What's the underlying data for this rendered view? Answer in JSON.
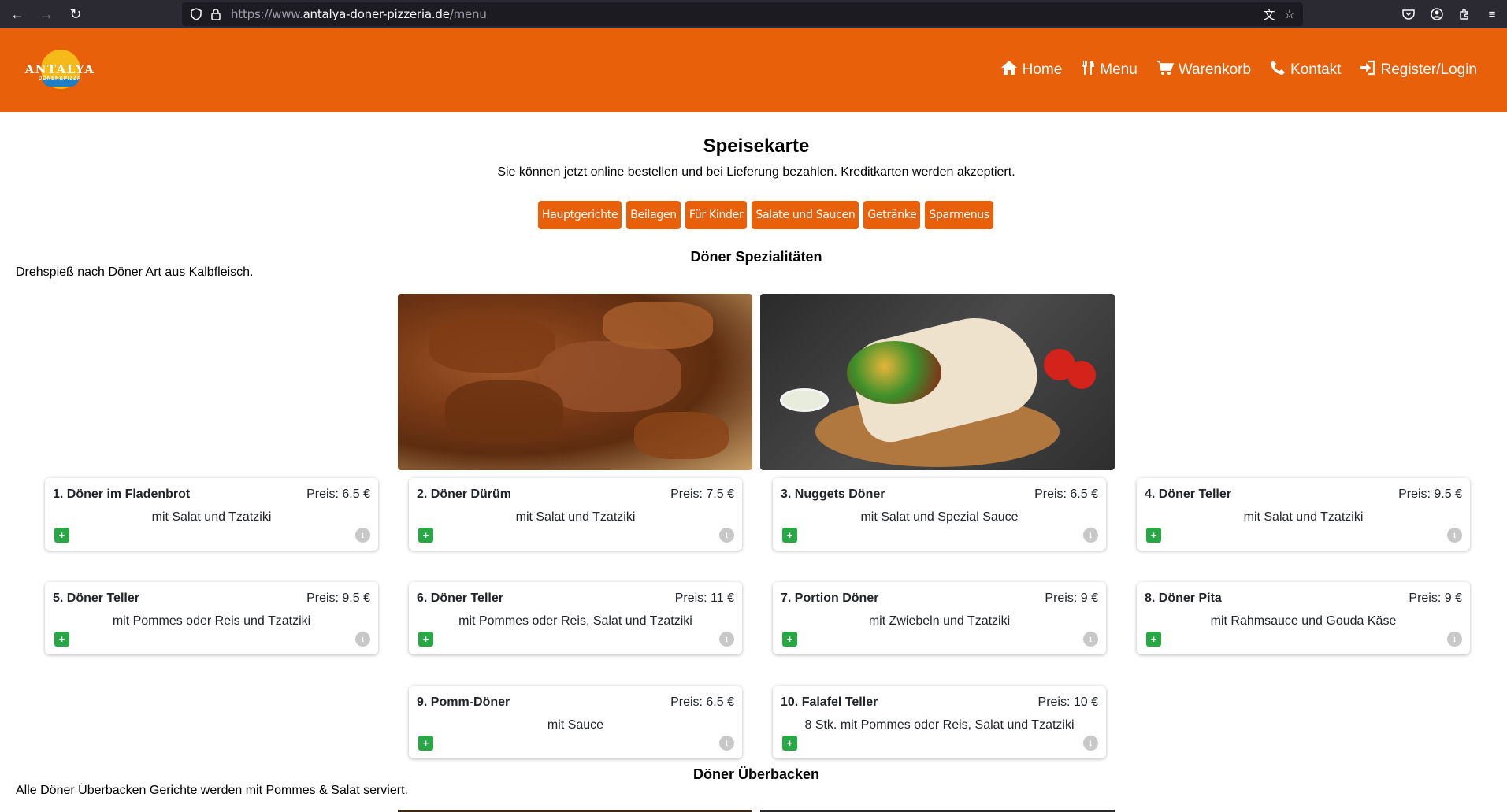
{
  "browser": {
    "url_prefix": "https://www.",
    "url_host": "antalya-doner-pizzeria.de",
    "url_path": "/menu"
  },
  "header": {
    "logo_text": "ANTALYA",
    "logo_sub": "DÖNER&PIZZA",
    "nav": [
      {
        "label": "Home",
        "icon": "home-icon"
      },
      {
        "label": "Menu",
        "icon": "utensils-icon"
      },
      {
        "label": "Warenkorb",
        "icon": "cart-icon"
      },
      {
        "label": "Kontakt",
        "icon": "phone-icon"
      },
      {
        "label": "Register/Login",
        "icon": "login-icon"
      }
    ]
  },
  "page": {
    "title": "Speisekarte",
    "subtitle": "Sie können jetzt online bestellen und bei Lieferung bezahlen. Kreditkarten werden akzeptiert."
  },
  "categories": [
    "Hauptgerichte",
    "Beilagen",
    "Für Kinder",
    "Salate und Saucen",
    "Getränke",
    "Sparmenus"
  ],
  "sections": [
    {
      "title": "Döner Spezialitäten",
      "description": "Drehspieß nach Döner Art aus Kalbfleisch.",
      "items": [
        {
          "name": "1. Döner im Fladenbrot",
          "price": "Preis: 6.5 €",
          "desc": "mit Salat und Tzatziki"
        },
        {
          "name": "2. Döner Dürüm",
          "price": "Preis: 7.5 €",
          "desc": "mit Salat und Tzatziki"
        },
        {
          "name": "3. Nuggets Döner",
          "price": "Preis: 6.5 €",
          "desc": "mit Salat und Spezial Sauce"
        },
        {
          "name": "4. Döner Teller",
          "price": "Preis: 9.5 €",
          "desc": "mit Salat und Tzatziki"
        },
        {
          "name": "5. Döner Teller",
          "price": "Preis: 9.5 €",
          "desc": "mit Pommes oder Reis und Tzatziki"
        },
        {
          "name": "6. Döner Teller",
          "price": "Preis: 11 €",
          "desc": "mit Pommes oder Reis, Salat und Tzatziki"
        },
        {
          "name": "7. Portion Döner",
          "price": "Preis: 9 €",
          "desc": "mit Zwiebeln und Tzatziki"
        },
        {
          "name": "8. Döner Pita",
          "price": "Preis: 9 €",
          "desc": "mit Rahmsauce und Gouda Käse"
        },
        {
          "name": "9. Pomm-Döner",
          "price": "Preis: 6.5 €",
          "desc": "mit Sauce"
        },
        {
          "name": "10. Falafel Teller",
          "price": "Preis: 10 €",
          "desc": "8 Stk. mit Pommes oder Reis, Salat und Tzatziki"
        }
      ]
    },
    {
      "title": "Döner Überbacken",
      "description": "Alle Döner Überbacken Gerichte werden mit Pommes & Salat serviert."
    }
  ],
  "buttons": {
    "add": "+",
    "info": "i"
  },
  "colors": {
    "brand": "#e8600a",
    "add": "#28a745",
    "info": "#c8c8c8"
  }
}
